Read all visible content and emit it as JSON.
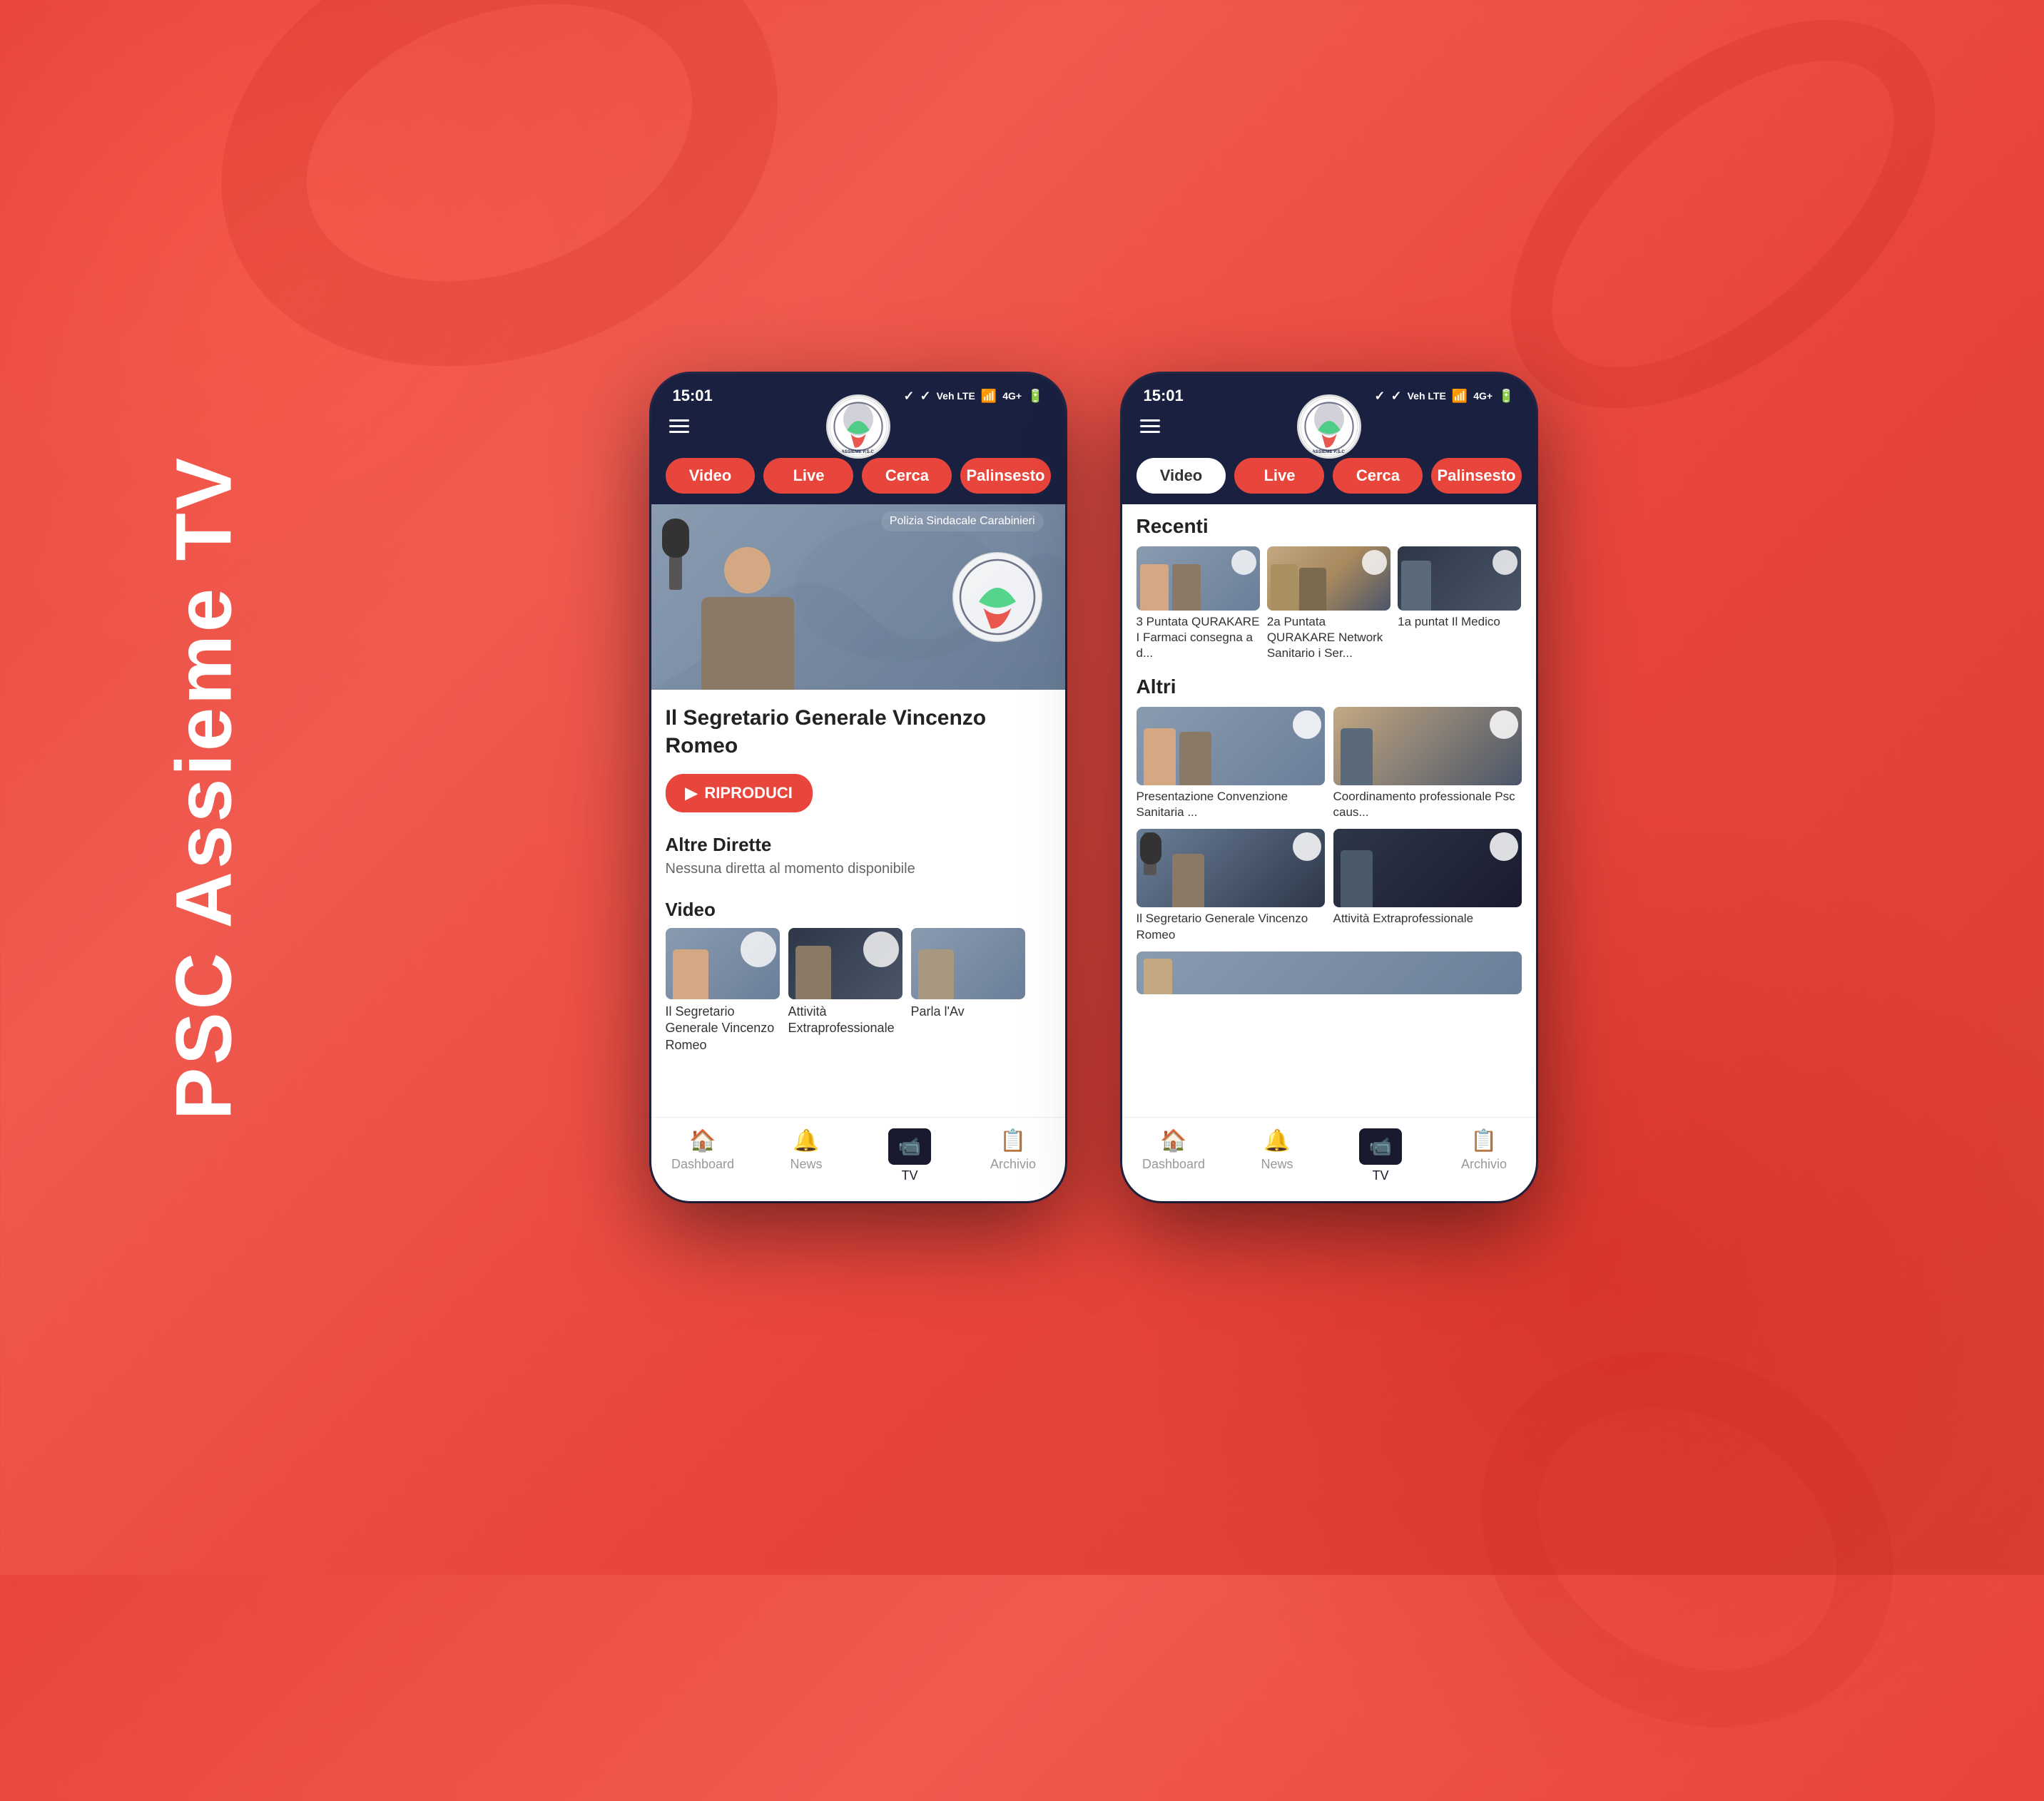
{
  "app": {
    "vertical_title": "PSC Assieme TV",
    "background_color": "#e8453c"
  },
  "phone_left": {
    "status_bar": {
      "time": "15:01",
      "signals": "Veh LTE",
      "network": "4G+"
    },
    "tabs": [
      {
        "label": "Video",
        "active": true
      },
      {
        "label": "Live",
        "active": false
      },
      {
        "label": "Cerca",
        "active": false
      },
      {
        "label": "Palinsesto",
        "active": false
      }
    ],
    "main_video": {
      "title": "Il Segretario Generale Vincenzo Romeo",
      "play_button": "RIPRODUCI"
    },
    "altre_dirette": {
      "title": "Altre Dirette",
      "subtitle": "Nessuna diretta al momento disponibile"
    },
    "video_section": {
      "title": "Video",
      "items": [
        {
          "label": "Il Segretario Generale Vincenzo Romeo"
        },
        {
          "label": "Attività Extraprofessionale"
        },
        {
          "label": "Parla l'Av"
        }
      ]
    },
    "bottom_nav": [
      {
        "label": "Dashboard",
        "icon": "home"
      },
      {
        "label": "News",
        "icon": "bell"
      },
      {
        "label": "TV",
        "icon": "tv",
        "active": true
      },
      {
        "label": "Archivio",
        "icon": "archive"
      }
    ]
  },
  "phone_right": {
    "status_bar": {
      "time": "15:01",
      "signals": "Veh LTE",
      "network": "4G+"
    },
    "tabs": [
      {
        "label": "Video",
        "active": true
      },
      {
        "label": "Live",
        "active": false
      },
      {
        "label": "Cerca",
        "active": false
      },
      {
        "label": "Palinsesto",
        "active": false
      }
    ],
    "recenti": {
      "title": "Recenti",
      "items": [
        {
          "label": "3 Puntata QURAKARE I Farmaci  consegna a d..."
        },
        {
          "label": "2a Puntata QURAKARE Network Sanitario i Ser..."
        },
        {
          "label": "1a puntat Il Medico"
        }
      ]
    },
    "altri": {
      "title": "Altri",
      "items": [
        {
          "label": "Presentazione Convenzione Sanitaria ..."
        },
        {
          "label": "Coordinamento professionale Psc caus..."
        },
        {
          "label": "Il Segretario Generale Vincenzo Romeo"
        },
        {
          "label": "Attività Extraprofessionale"
        }
      ]
    },
    "bottom_nav": [
      {
        "label": "Dashboard",
        "icon": "home"
      },
      {
        "label": "News",
        "icon": "bell"
      },
      {
        "label": "TV",
        "icon": "tv",
        "active": true
      },
      {
        "label": "Archivio",
        "icon": "archive"
      }
    ]
  }
}
